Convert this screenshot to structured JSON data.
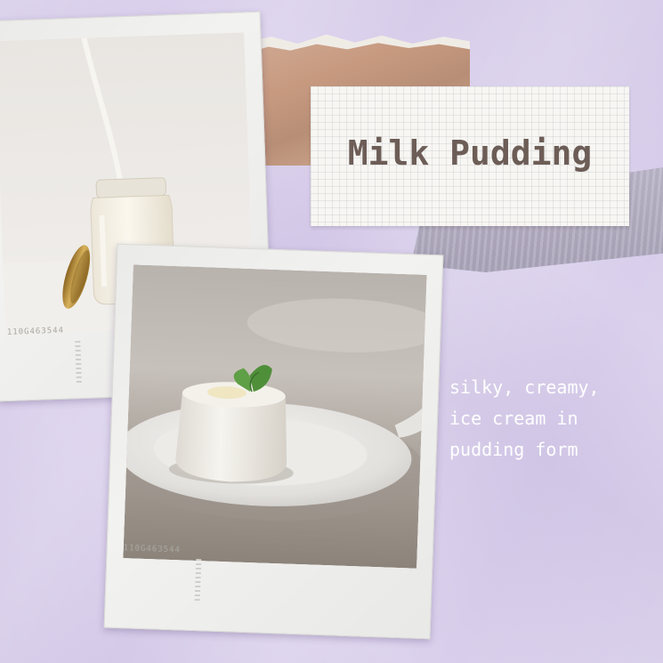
{
  "title": "Milk Pudding",
  "tagline": [
    "silky, creamy,",
    "ice cream in",
    "pudding form"
  ],
  "photo_1": {
    "film_code": "110G463544",
    "subject": "milk pouring into jar"
  },
  "photo_2": {
    "film_code": "110G463544",
    "subject": "milk pudding with mint on plate"
  },
  "colors": {
    "background": "#dad0ec",
    "title_text": "#6d5d57",
    "kraft_paper": "#c79a80",
    "tape": "#b0aabf",
    "tagline_text": "#ffffff"
  }
}
